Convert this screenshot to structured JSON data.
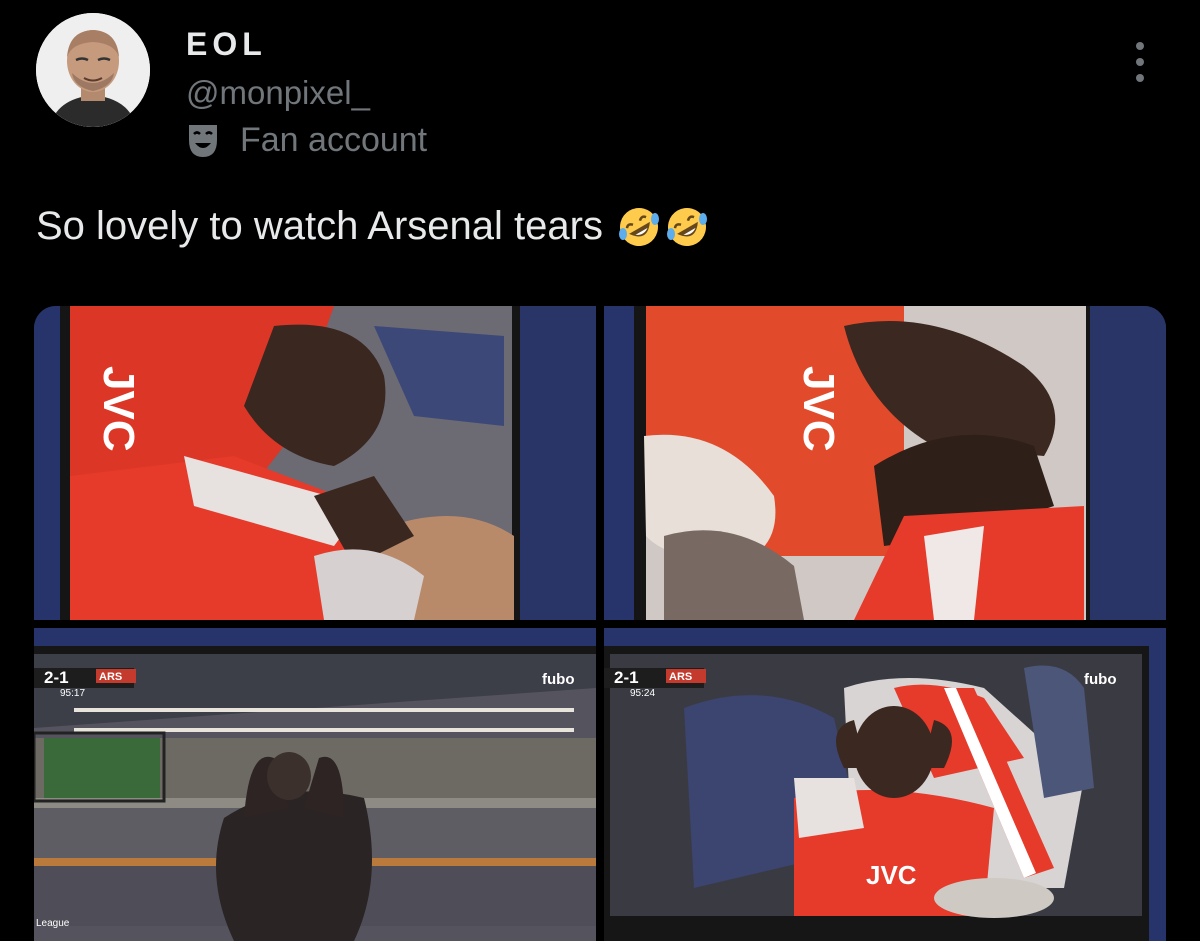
{
  "post": {
    "display_name": "EOL",
    "handle": "@monpixel_",
    "badge_label": "Fan account",
    "badge_icon": "theater-mask-icon",
    "text": "So lovely to watch Arsenal tears",
    "emoji": [
      "rolling-on-floor-laughing-emoji",
      "rolling-on-floor-laughing-emoji"
    ],
    "more_icon": "more-vertical-icon"
  },
  "media": [
    {
      "shirt_text": "JVC"
    },
    {
      "shirt_text": "JVC"
    },
    {
      "score": "2-1",
      "team": "ARS",
      "clock": "95:17",
      "broadcaster": "fubo",
      "side_text": "League"
    },
    {
      "score": "2-1",
      "team": "ARS",
      "clock": "95:24",
      "broadcaster": "fubo",
      "shirt_text": "JVC"
    }
  ],
  "colors": {
    "background": "#000000",
    "text": "#e7e9ea",
    "secondary": "#71767b",
    "arsenal_red": "#e63a2b"
  }
}
